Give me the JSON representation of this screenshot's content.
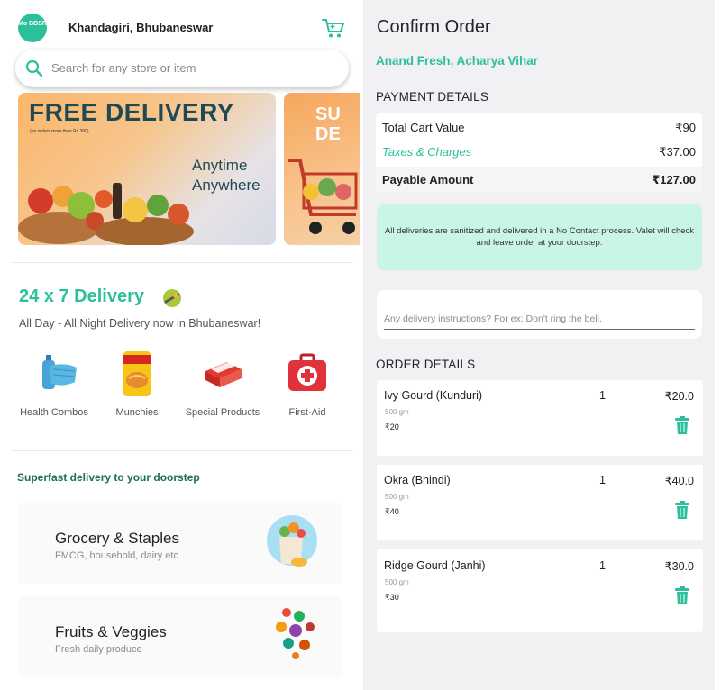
{
  "left": {
    "logo_text": "Mo BBSR",
    "location": "Khandagiri, Bhubaneswar",
    "search_placeholder": "Search for any store or item",
    "banner1": {
      "title": "FREE DELIVERY",
      "subtitle": "(on orders more than Rs.300)",
      "tagline1": "Anytime",
      "tagline2": "Anywhere"
    },
    "banner2": {
      "text": "SU DE"
    },
    "delivery": {
      "title": "24 x 7 Delivery",
      "subtitle": "All Day - All Night Delivery now in Bhubaneswar!"
    },
    "categories": [
      {
        "label": "Health Combos",
        "icon": "health-combo-icon"
      },
      {
        "label": "Munchies",
        "icon": "munchies-icon"
      },
      {
        "label": "Special Products",
        "icon": "special-products-icon"
      },
      {
        "label": "First-Aid",
        "icon": "first-aid-icon"
      }
    ],
    "superfast": "Superfast delivery to your doorstep",
    "stores": [
      {
        "title": "Grocery & Staples",
        "subtitle": "FMCG, household, dairy etc"
      },
      {
        "title": "Fruits & Veggies",
        "subtitle": "Fresh daily produce"
      }
    ]
  },
  "right": {
    "title": "Confirm Order",
    "store_name": "Anand Fresh, Acharya Vihar",
    "payment_heading": "PAYMENT DETAILS",
    "payment": {
      "total_label": "Total Cart Value",
      "total_value": "₹90",
      "taxes_label": "Taxes & Charges",
      "taxes_value": "₹37.00",
      "payable_label": "Payable Amount",
      "payable_value": "₹127.00"
    },
    "notice": "All deliveries are sanitized and delivered in a No Contact process. Valet will check and leave order at your doorstep.",
    "instructions_placeholder": "Any delivery instructions? For ex: Don't ring the bell.",
    "order_heading": "ORDER DETAILS",
    "items": [
      {
        "name": "Ivy Gourd (Kunduri)",
        "qty": "1",
        "price": "₹20.0",
        "weight": "500 gm",
        "unit_price": "₹20"
      },
      {
        "name": "Okra (Bhindi)",
        "qty": "1",
        "price": "₹40.0",
        "weight": "500 gm",
        "unit_price": "₹40"
      },
      {
        "name": "Ridge Gourd (Janhi)",
        "qty": "1",
        "price": "₹30.0",
        "weight": "500 gm",
        "unit_price": "₹30"
      }
    ]
  },
  "colors": {
    "accent": "#2bbf9b",
    "dark_teal": "#1f4a54",
    "notice_bg": "#c8f5e4",
    "panel_bg": "#f1f1f3"
  }
}
